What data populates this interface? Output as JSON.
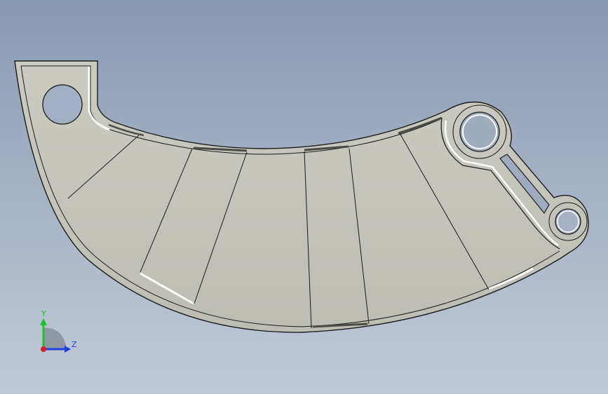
{
  "viewport": {
    "background_top": "#8899b3",
    "background_bottom": "#c2cad8"
  },
  "part": {
    "face_color": "#c5c5bc",
    "edge_color": "#1a1a1a",
    "highlight_color": "#ffffff"
  },
  "triad": {
    "y_label": "Y",
    "z_label": "Z",
    "y_color": "#1fbf2a",
    "z_color": "#1f3fdc",
    "x_color": "#d42020"
  }
}
